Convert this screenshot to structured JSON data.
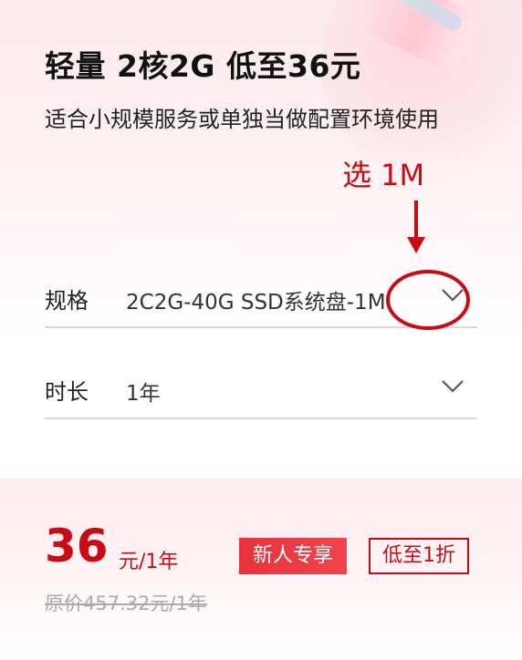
{
  "product": {
    "title": "轻量 2核2G 低至36元",
    "description": "适合小规模服务或单独当做配置环境使用"
  },
  "annotation": {
    "label": "选 1M",
    "color": "#cc0a14"
  },
  "spec": {
    "label": "规格",
    "value": "2C2G-40G SSD系统盘-1M"
  },
  "duration": {
    "label": "时长",
    "value": "1年"
  },
  "price": {
    "amount": "36",
    "unit": "元/1年",
    "badge_new": "新人专享",
    "badge_discount": "低至1折",
    "original": "原价457.32元/1年",
    "accent_color": "#cc0a14"
  },
  "icons": {
    "dropdown": "chevron-down-icon",
    "arrow": "arrow-down-icon"
  }
}
